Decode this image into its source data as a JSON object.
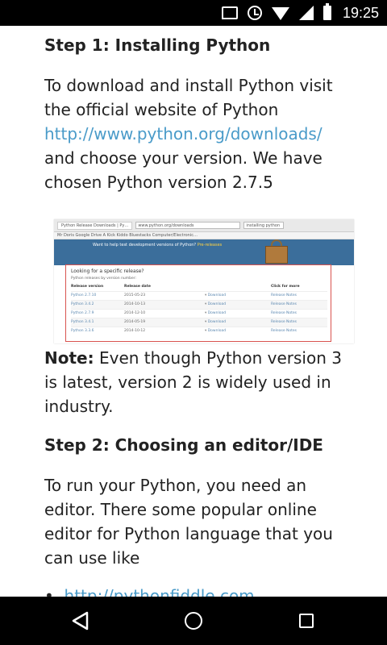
{
  "status_bar": {
    "time": "19:25",
    "icons": [
      "cast-icon",
      "alarm-icon",
      "wifi-icon",
      "signal-icon",
      "battery-icon"
    ]
  },
  "article": {
    "step1_heading": "Step 1: Installing Python",
    "step1_p1": "To download and install Python visit the official website of Python",
    "step1_link": "http://www.python.org/downloads/",
    "step1_p2": "and choose your version. We have chosen Python version 2.7.5",
    "note_label": "Note:",
    "note_text": "Even though Python version 3 is latest, version 2 is widely used in industry.",
    "step2_heading": "Step 2: Choosing an editor/IDE",
    "step2_p": "To run your Python, you need an editor. There some popular online editor for Python language that you can use like",
    "bullet_link": "http://pythonfiddle.com"
  },
  "embedded_screenshot": {
    "tab_title": "Python Release Downloads | Py…",
    "url": "www.python.org/downloads",
    "search": "installing python",
    "bookmarks": "Mr Doris   Google Drive   A Kick Kiddo   Bluestacks   Computer/Electronic…",
    "banner_text": "Want to help test development versions of Python?",
    "banner_link": "Pre-releases",
    "box_title": "Looking for a specific release?",
    "box_subtitle": "Python releases by version number:",
    "columns": [
      "Release version",
      "Release date",
      "",
      "Click for more"
    ],
    "rows": [
      {
        "version": "Python 2.7.10",
        "date": "2015-05-23",
        "download": "Download",
        "notes": "Release Notes"
      },
      {
        "version": "Python 3.4.2",
        "date": "2014-10-13",
        "download": "Download",
        "notes": "Release Notes"
      },
      {
        "version": "Python 2.7.9",
        "date": "2014-12-10",
        "download": "Download",
        "notes": "Release Notes"
      },
      {
        "version": "Python 3.4.1",
        "date": "2014-05-19",
        "download": "Download",
        "notes": "Release Notes"
      },
      {
        "version": "Python 3.3.6",
        "date": "2014-10-12",
        "download": "Download",
        "notes": "Release Notes"
      }
    ]
  },
  "nav_bar": {
    "icons": [
      "back-icon",
      "home-icon",
      "recents-icon"
    ]
  }
}
